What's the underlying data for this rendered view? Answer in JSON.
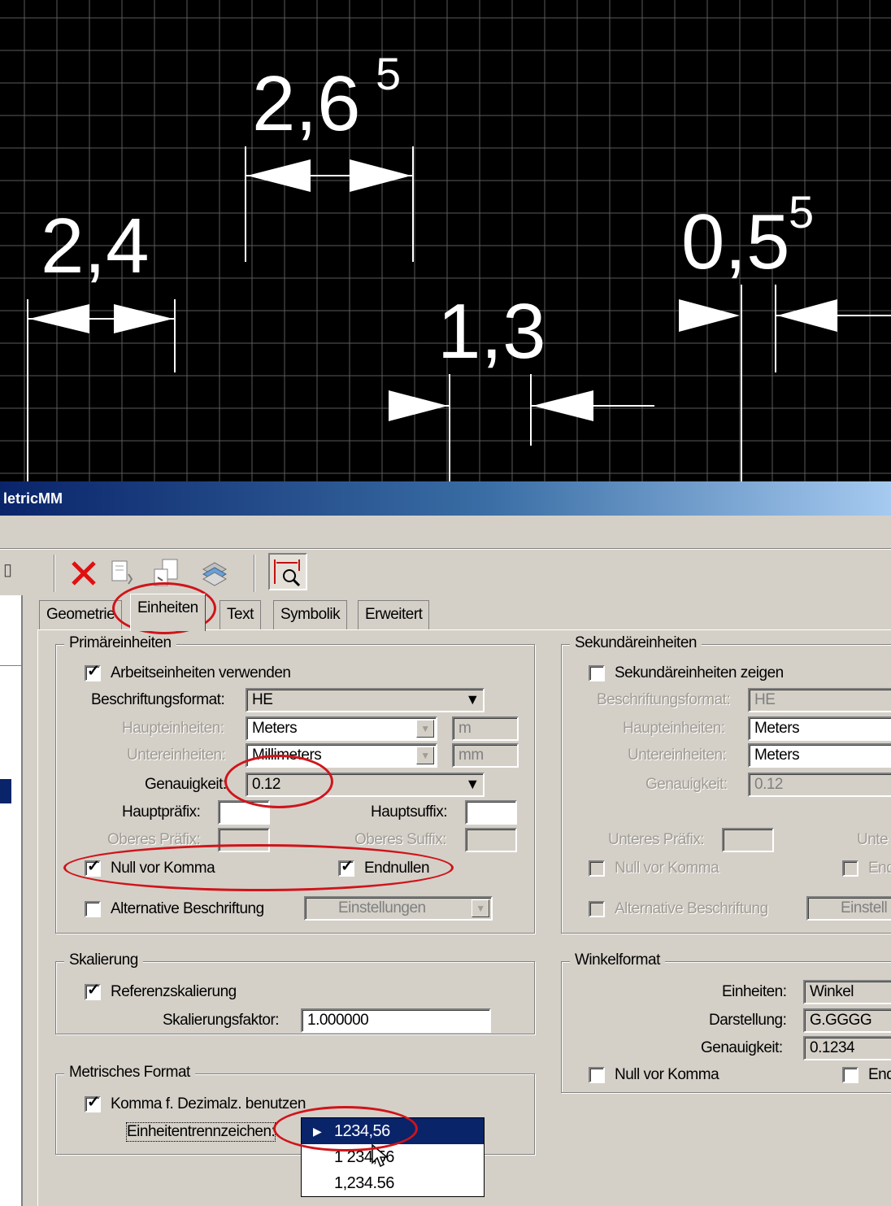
{
  "drawing": {
    "dimensions": [
      {
        "label": "2,4",
        "superscript": ""
      },
      {
        "label": "2,6",
        "superscript": "5"
      },
      {
        "label": "1,3",
        "superscript": ""
      },
      {
        "label": "0,5",
        "superscript": "5"
      }
    ]
  },
  "dialog": {
    "title": "letricMM",
    "tabs": [
      "Geometrie",
      "Einheiten",
      "Text",
      "Symbolik",
      "Erweitert"
    ],
    "active_tab": "Einheiten",
    "primary": {
      "title": "Primäreinheiten",
      "use_working_units": {
        "label": "Arbeitseinheiten verwenden",
        "checked": true
      },
      "label_format": {
        "label": "Beschriftungsformat:",
        "value": "HE"
      },
      "master_units": {
        "label": "Haupteinheiten:",
        "value": "Meters",
        "suffix": "m"
      },
      "sub_units": {
        "label": "Untereinheiten:",
        "value": "Millimeters",
        "suffix": "mm"
      },
      "accuracy": {
        "label": "Genauigkeit:",
        "value": "0.12"
      },
      "main_prefix": {
        "label": "Hauptpräfix:",
        "value": ""
      },
      "main_suffix": {
        "label": "Hauptsuffix:",
        "value": ""
      },
      "upper_prefix": {
        "label": "Oberes Präfix:",
        "value": ""
      },
      "upper_suffix": {
        "label": "Oberes Suffix:",
        "value": ""
      },
      "leading_zero": {
        "label": "Null vor Komma",
        "checked": true
      },
      "trailing_zeros": {
        "label": "Endnullen",
        "checked": true
      },
      "alt_label": {
        "label": "Alternative Beschriftung",
        "checked": false
      },
      "settings_combo": {
        "value": "Einstellungen"
      }
    },
    "secondary": {
      "title": "Sekundäreinheiten",
      "show_secondary": {
        "label": "Sekundäreinheiten zeigen",
        "checked": false
      },
      "label_format": {
        "label": "Beschriftungsformat:",
        "value": "HE"
      },
      "master_units": {
        "label": "Haupteinheiten:",
        "value": "Meters"
      },
      "sub_units": {
        "label": "Untereinheiten:",
        "value": "Meters"
      },
      "accuracy": {
        "label": "Genauigkeit:",
        "value": "0.12"
      },
      "lower_prefix": {
        "label": "Unteres Präfix:",
        "value": ""
      },
      "lower_suffix_partial": "Unte",
      "leading_zero": {
        "label": "Null vor Komma",
        "checked": false
      },
      "trailing_partial": "End",
      "alt_label": {
        "label": "Alternative Beschriftung",
        "checked": false
      },
      "settings_partial": "Einstell"
    },
    "scaling": {
      "title": "Skalierung",
      "ref_scaling": {
        "label": "Referenzskalierung",
        "checked": true
      },
      "factor": {
        "label": "Skalierungsfaktor:",
        "value": "1.000000"
      }
    },
    "angle": {
      "title": "Winkelformat",
      "units": {
        "label": "Einheiten:",
        "value": "Winkel"
      },
      "display": {
        "label": "Darstellung:",
        "value": "G.GGGG"
      },
      "accuracy": {
        "label": "Genauigkeit:",
        "value": "0.1234"
      },
      "leading_zero": {
        "label": "Null vor Komma",
        "checked": false
      },
      "trailing_partial": "End"
    },
    "metric": {
      "title": "Metrisches Format",
      "use_comma": {
        "label": "Komma f. Dezimalz. benutzen",
        "checked": true
      },
      "separator": {
        "label": "Einheitentrennzeichen:"
      },
      "options": [
        "1234,56",
        "1 234,56",
        "1,234.56"
      ],
      "selected_index": 0
    }
  },
  "colors": {
    "annotation": "#d0141a",
    "selection": "#0a246a",
    "dialog_bg": "#d4d0c8"
  }
}
